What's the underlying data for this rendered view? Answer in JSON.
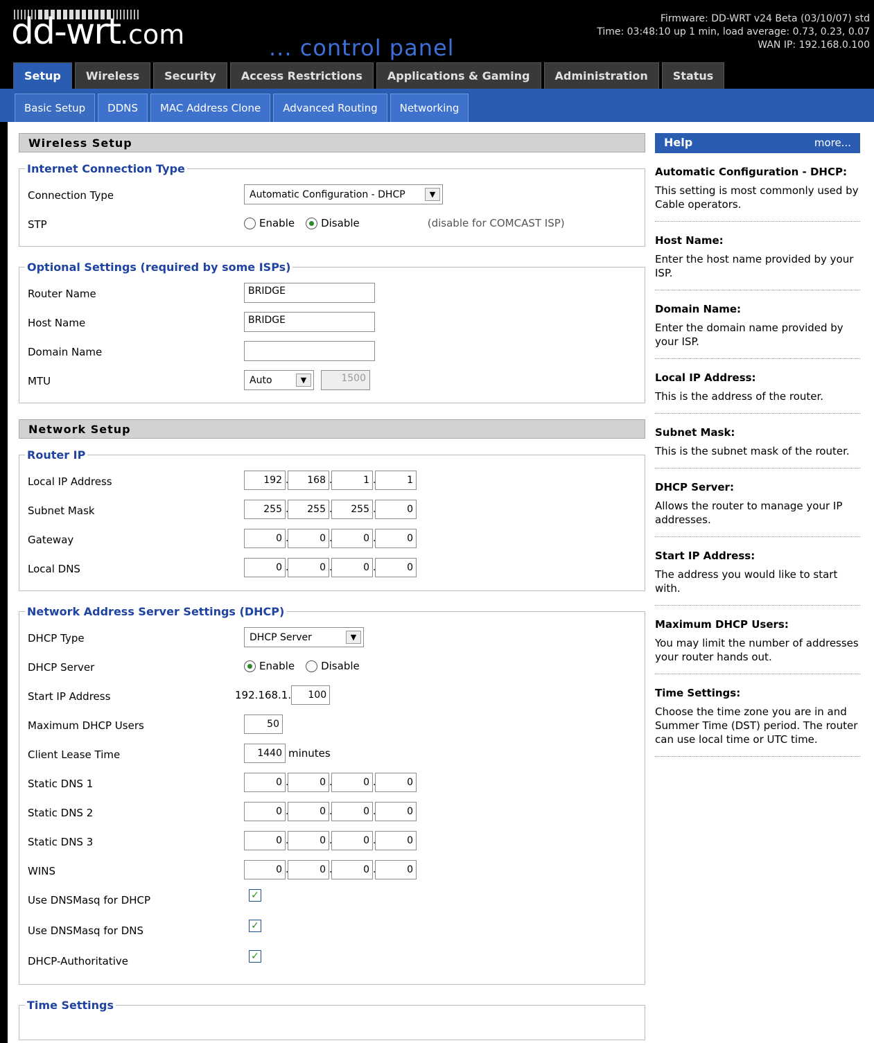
{
  "header": {
    "logo_main": "dd-wrt",
    "logo_suffix": ".com",
    "panel_title": "... control panel",
    "firmware": "Firmware: DD-WRT v24 Beta (03/10/07) std",
    "time": "Time: 03:48:10 up 1 min, load average: 0.73, 0.23, 0.07",
    "wan_ip": "WAN IP: 192.168.0.100"
  },
  "tabs": [
    "Setup",
    "Wireless",
    "Security",
    "Access Restrictions",
    "Applications & Gaming",
    "Administration",
    "Status"
  ],
  "subtabs": [
    "Basic Setup",
    "DDNS",
    "MAC Address Clone",
    "Advanced Routing",
    "Networking"
  ],
  "wireless_setup": {
    "title": "Wireless Setup",
    "internet": {
      "legend": "Internet Connection Type",
      "connection_type_label": "Connection Type",
      "connection_type_value": "Automatic Configuration - DHCP",
      "stp_label": "STP",
      "enable": "Enable",
      "disable": "Disable",
      "stp_note": "(disable for COMCAST ISP)"
    },
    "optional": {
      "legend": "Optional Settings (required by some ISPs)",
      "router_name_label": "Router Name",
      "router_name": "BRIDGE",
      "host_name_label": "Host Name",
      "host_name": "BRIDGE",
      "domain_name_label": "Domain Name",
      "domain_name": "",
      "mtu_label": "MTU",
      "mtu_mode": "Auto",
      "mtu_value": "1500"
    }
  },
  "network_setup": {
    "title": "Network Setup",
    "router_ip": {
      "legend": "Router IP",
      "local_ip_label": "Local IP Address",
      "local_ip": [
        "192",
        "168",
        "1",
        "1"
      ],
      "subnet_label": "Subnet Mask",
      "subnet": [
        "255",
        "255",
        "255",
        "0"
      ],
      "gateway_label": "Gateway",
      "gateway": [
        "0",
        "0",
        "0",
        "0"
      ],
      "local_dns_label": "Local DNS",
      "local_dns": [
        "0",
        "0",
        "0",
        "0"
      ]
    },
    "dhcp": {
      "legend": "Network Address Server Settings (DHCP)",
      "type_label": "DHCP Type",
      "type_value": "DHCP Server",
      "server_label": "DHCP Server",
      "enable": "Enable",
      "disable": "Disable",
      "start_label": "Start IP Address",
      "start_prefix": "192.168.1.",
      "start_value": "100",
      "max_label": "Maximum DHCP Users",
      "max_value": "50",
      "lease_label": "Client Lease Time",
      "lease_value": "1440",
      "lease_unit": "minutes",
      "dns1_label": "Static DNS 1",
      "dns1": [
        "0",
        "0",
        "0",
        "0"
      ],
      "dns2_label": "Static DNS 2",
      "dns2": [
        "0",
        "0",
        "0",
        "0"
      ],
      "dns3_label": "Static DNS 3",
      "dns3": [
        "0",
        "0",
        "0",
        "0"
      ],
      "wins_label": "WINS",
      "wins": [
        "0",
        "0",
        "0",
        "0"
      ],
      "dnsmasq_dhcp_label": "Use DNSMasq for DHCP",
      "dnsmasq_dns_label": "Use DNSMasq for DNS",
      "authoritative_label": "DHCP-Authoritative"
    },
    "time_legend": "Time Settings"
  },
  "help": {
    "title": "Help",
    "more": "more...",
    "items": [
      {
        "title": "Automatic Configuration - DHCP:",
        "text": "This setting is most commonly used by Cable operators."
      },
      {
        "title": "Host Name:",
        "text": "Enter the host name provided by your ISP."
      },
      {
        "title": "Domain Name:",
        "text": "Enter the domain name provided by your ISP."
      },
      {
        "title": "Local IP Address:",
        "text": "This is the address of the router."
      },
      {
        "title": "Subnet Mask:",
        "text": "This is the subnet mask of the router."
      },
      {
        "title": "DHCP Server:",
        "text": "Allows the router to manage your IP addresses."
      },
      {
        "title": "Start IP Address:",
        "text": "The address you would like to start with."
      },
      {
        "title": "Maximum DHCP Users:",
        "text": "You may limit the number of addresses your router hands out."
      },
      {
        "title": "Time Settings:",
        "text": "Choose the time zone you are in and Summer Time (DST) period. The router can use local time or UTC time."
      }
    ]
  }
}
